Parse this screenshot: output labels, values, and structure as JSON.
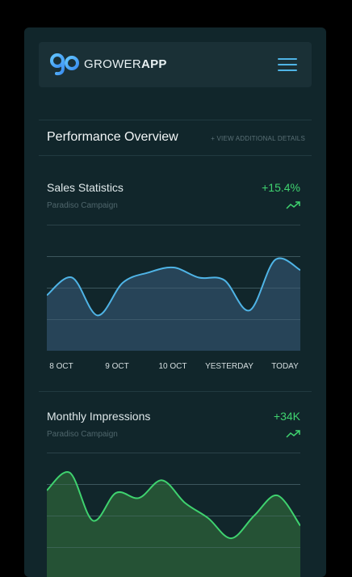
{
  "app": {
    "brand_part1": "GROWER",
    "brand_part2": "APP",
    "logo_text": "ga",
    "menu_icon": "hamburger-icon"
  },
  "overview": {
    "title": "Performance Overview",
    "details_link": "+ VIEW ADDITIONAL DETAILS"
  },
  "colors": {
    "accent_blue": "#4fb4e6",
    "accent_green": "#3fd26f",
    "background": "#11262b"
  },
  "cards": [
    {
      "title": "Sales Statistics",
      "subtitle": "Paradiso Campaign",
      "change": "+15.4%",
      "trend_icon": "trending-up-icon",
      "chart_data": {
        "type": "area",
        "title": "Sales Statistics",
        "categories": [
          "8 OCT",
          "9 OCT",
          "10 OCT",
          "YESTERDAY",
          "TODAY"
        ],
        "ylim": [
          0,
          5
        ],
        "grid": true,
        "series": [
          {
            "values": [
              2.2,
              2.9,
              1.4,
              2.7,
              3.1,
              3.3,
              2.9,
              2.8,
              1.6,
              3.6,
              3.2
            ]
          }
        ],
        "x": [
          0,
          0.5,
          1,
          1.5,
          2,
          2.5,
          3,
          3.5,
          4,
          4.5,
          5
        ],
        "line_color": "#4fb4e6",
        "fill_color": "#2b4a60"
      }
    },
    {
      "title": "Monthly Impressions",
      "subtitle": "Paradiso Campaign",
      "change": "+34K",
      "trend_icon": "trending-up-icon",
      "chart_data": {
        "type": "area",
        "title": "Monthly Impressions",
        "categories": [],
        "ylim": [
          0,
          5
        ],
        "grid": true,
        "series": [
          {
            "values": [
              3.5,
              4.2,
              2.3,
              3.4,
              3.2,
              3.9,
              3.0,
              2.4,
              1.6,
              2.5,
              3.3,
              2.1
            ]
          }
        ],
        "x": [
          0,
          0.5,
          1,
          1.5,
          2,
          2.5,
          3,
          3.5,
          4,
          4.5,
          5,
          5.5
        ],
        "line_color": "#3fd26f",
        "fill_color": "#295a37"
      }
    }
  ]
}
